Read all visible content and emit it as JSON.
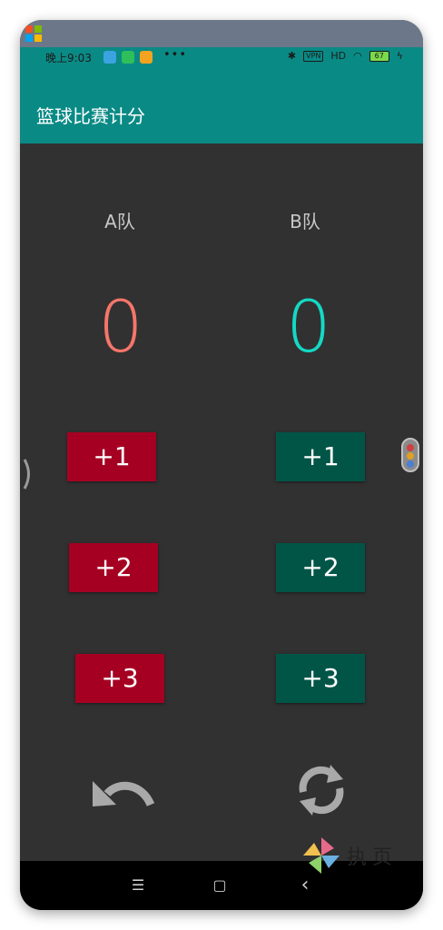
{
  "status_bar": {
    "time": "晚上9:03",
    "dots": "•••",
    "vpn": "VPN",
    "signal": "HD",
    "battery": "67"
  },
  "app_bar": {
    "title": "篮球比赛计分"
  },
  "teams": {
    "a": {
      "label": "A队",
      "score": "0",
      "score_color": "#f5766a",
      "button_color": "#a50022"
    },
    "b": {
      "label": "B队",
      "score": "0",
      "score_color": "#14d9c5",
      "button_color": "#015547"
    }
  },
  "buttons": {
    "plus1": "+1",
    "plus2": "+2",
    "plus3": "+3"
  },
  "actions": {
    "undo_icon": "undo-icon",
    "reset_icon": "refresh-icon"
  },
  "nav": {
    "menu": "☰",
    "home": "▢",
    "back": "‹"
  },
  "watermark": {
    "text": "执页"
  }
}
